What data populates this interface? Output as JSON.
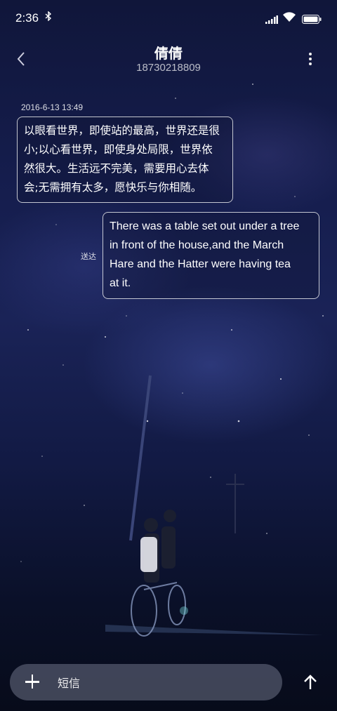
{
  "status_bar": {
    "time": "2:36",
    "icons": [
      "bluetooth-icon",
      "signal-icon",
      "wifi-icon",
      "battery-icon"
    ]
  },
  "header": {
    "contact_name": "倩倩",
    "contact_number": "18730218809",
    "icons": [
      "back-arrow-icon",
      "more-vertical-icon"
    ]
  },
  "conversation": {
    "timestamp": "2016-6-13 13:49",
    "messages": [
      {
        "direction": "incoming",
        "text": "以眼看世界，即使站的最高，世界还是很\n小;以心看世界，即使身处局限，世界依\n然很大。生活远不完美，需要用心去体\n会;无需拥有太多，愿快乐与你相随。"
      },
      {
        "direction": "outgoing",
        "status": "送达",
        "text": "There was a table set out under a tree\nin front of the house,and the March\nHare and the Hatter were having tea\nat it."
      }
    ]
  },
  "composer": {
    "placeholder": "短信",
    "value": "",
    "icons": [
      "add-icon",
      "send-arrow-icon"
    ]
  },
  "colors": {
    "background_top": "#10163a",
    "background_bottom": "#070b1a",
    "bubble_border": "#ffffff",
    "input_bar": "#6e7387"
  }
}
